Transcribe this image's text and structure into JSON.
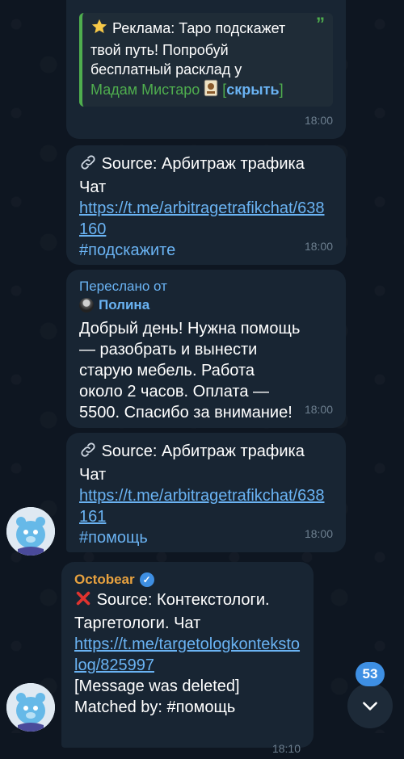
{
  "messages": [
    {
      "ad": {
        "text": "Реклама: Таро подскажет твой путь! Попробуй бесплатный расклад у",
        "brand": "Мадам Мистаро",
        "hide_label": "скрыть",
        "icon": "star-emoji",
        "quote_icon": "quote-icon"
      },
      "time": "18:00"
    },
    {
      "source_line": "Source: Арбитраж трафика Чат",
      "link": "https://t.me/arbitragetrafikchat/638160",
      "hashtag": "#подскажите",
      "time": "18:00",
      "icon": "link-icon"
    },
    {
      "forwarded_label": "Переслано от",
      "forwarded_user": "Полина",
      "text": "Добрый день! Нужна помощь — разобрать и вынести старую мебель. Работа около 2 часов. Оплата — 5500. Спасибо за внимание!",
      "time": "18:00"
    },
    {
      "source_line": "Source: Арбитраж трафика Чат",
      "link": "https://t.me/arbitragetrafikchat/638161",
      "hashtag": "#помощь",
      "time": "18:00",
      "icon": "link-icon"
    },
    {
      "sender": "Octobear",
      "source_line": "Source: Контекстологи. Таргетологи. Чат",
      "link": "https://t.me/targetologkontekstolog/825997",
      "deleted": "[Message was deleted]",
      "matched": "Matched by: #помощь",
      "time": "18:10",
      "icon": "red-x-icon"
    }
  ],
  "scroll": {
    "unread_count": "53"
  },
  "colors": {
    "background": "#0e1621",
    "bubble": "#182533",
    "link": "#6ab3f3",
    "accent_green": "#4fae4e",
    "sender_orange": "#e8a23f",
    "badge": "#3e8fe3"
  }
}
